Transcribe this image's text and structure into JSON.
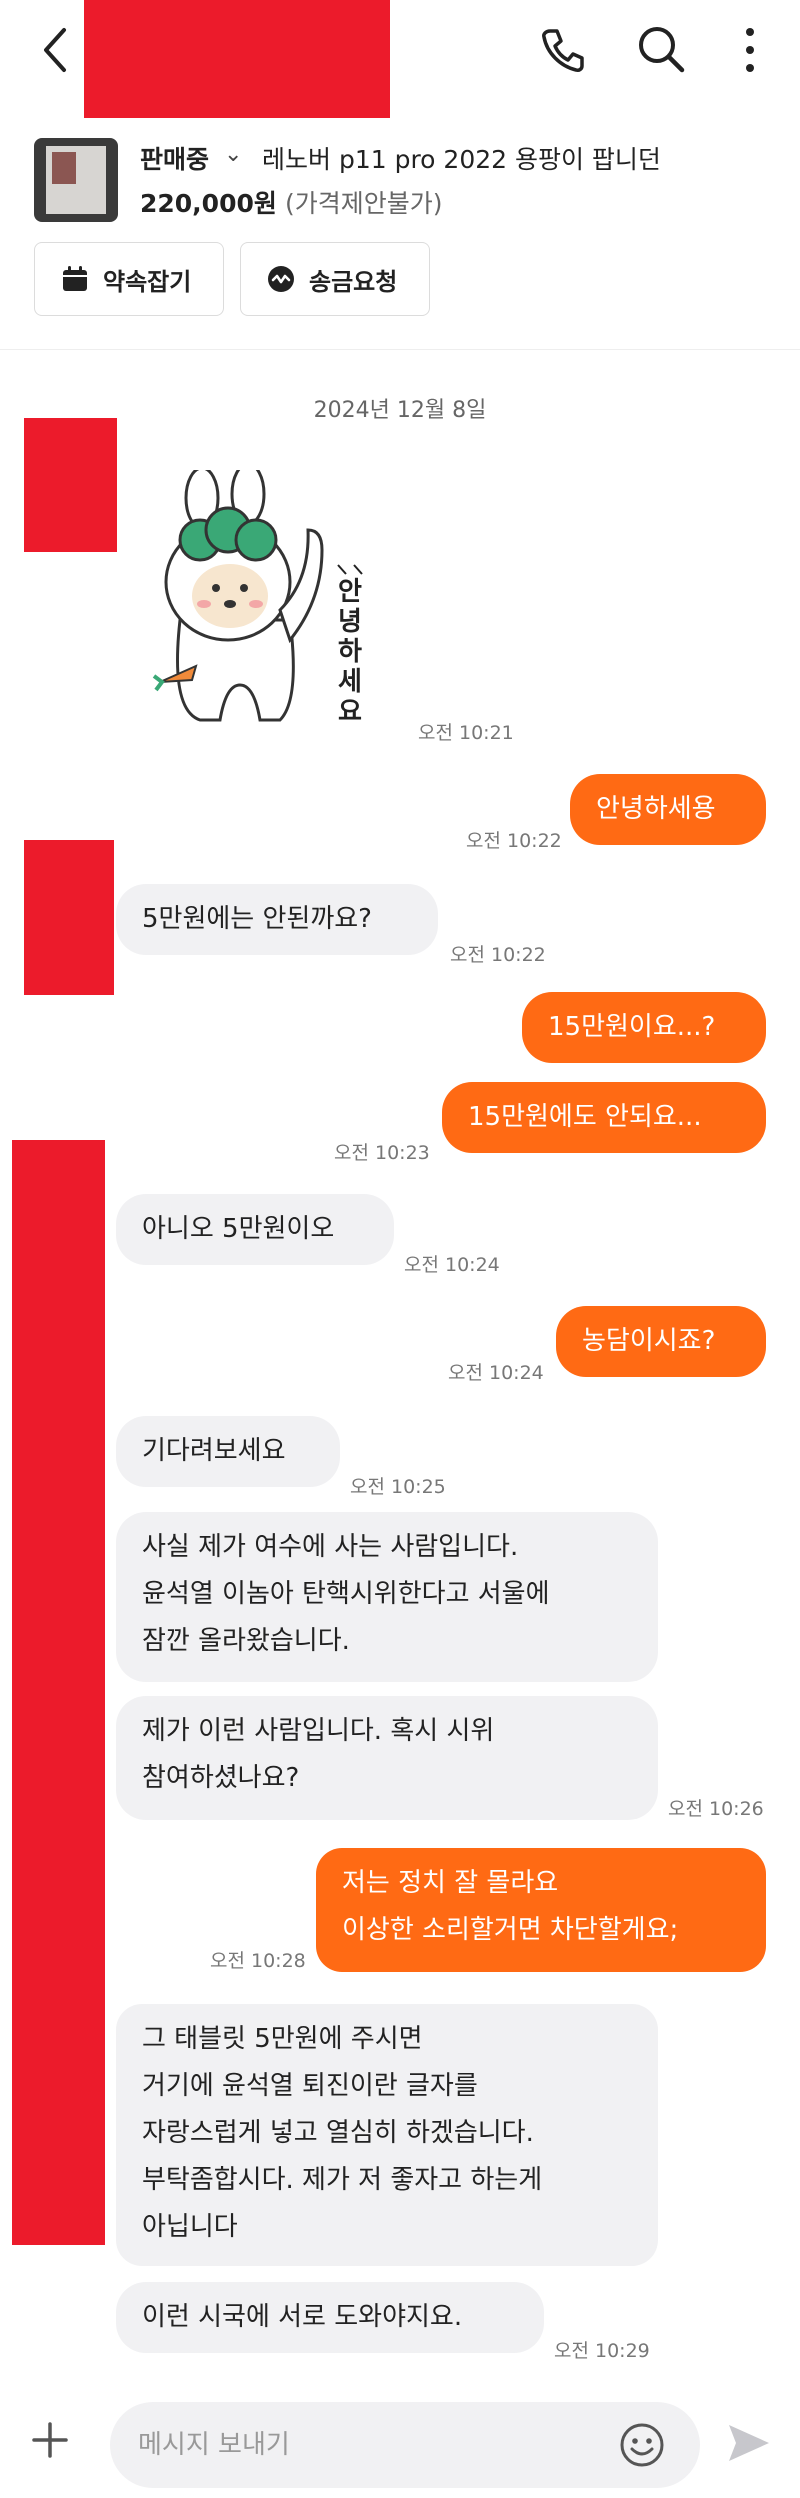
{
  "header": {
    "back_icon": "chevron-left-icon",
    "call_icon": "phone-icon",
    "search_icon": "search-icon",
    "more_icon": "more-vertical-icon"
  },
  "product": {
    "status": "판매중",
    "title": "레노버 p11 pro 2022 용팡이 팝니던",
    "price": "220,000원",
    "price_note": "(가격제안불가)",
    "schedule_button": "약속잡기",
    "transfer_button": "송금요청"
  },
  "chat": {
    "date": "2024년 12월 8일",
    "sticker_text": "안녕하세요",
    "messages": [
      {
        "from": "other",
        "type": "sticker",
        "time": "오전 10:21"
      },
      {
        "from": "me",
        "text": "안녕하세용",
        "time": "오전 10:22"
      },
      {
        "from": "other",
        "text": "5만원에는 안된까요?",
        "time": "오전 10:22"
      },
      {
        "from": "me",
        "text": "15만원이요...?",
        "time": ""
      },
      {
        "from": "me",
        "text": "15만원에도 안되요...",
        "time": "오전 10:23"
      },
      {
        "from": "other",
        "text": "아니오 5만원이오",
        "time": "오전 10:24"
      },
      {
        "from": "me",
        "text": "농담이시죠?",
        "time": "오전 10:24"
      },
      {
        "from": "other",
        "text": "기다려보세요",
        "time": "오전 10:25"
      },
      {
        "from": "other",
        "lines": [
          "사실 제가 여수에 사는 사람입니다.",
          "윤석열 이놈아 탄핵시위한다고 서울에",
          "잠깐 올라왔습니다."
        ],
        "time": ""
      },
      {
        "from": "other",
        "lines": [
          "제가 이런 사람입니다. 혹시 시위",
          "참여하셨나요?"
        ],
        "time": "오전 10:26"
      },
      {
        "from": "me",
        "lines": [
          "저는 정치 잘 몰라요",
          "이상한 소리할거면 차단할게요;"
        ],
        "time": "오전 10:28"
      },
      {
        "from": "other",
        "lines": [
          "그 태블릿 5만원에 주시면",
          "거기에 윤석열 퇴진이란 글자를",
          "자랑스럽게 넣고 열심히 하겠습니다.",
          "부탁좀합시다. 제가 저 좋자고 하는게",
          "아닙니다"
        ],
        "time": ""
      },
      {
        "from": "other",
        "text": "이런 시국에 서로 도와야지요.",
        "time": "오전 10:29"
      }
    ]
  },
  "input": {
    "placeholder": "메시지 보내기",
    "add_icon": "plus-icon",
    "emoji_icon": "smile-icon",
    "send_icon": "send-icon"
  },
  "colors": {
    "accent": "#ff6a14",
    "redaction": "#ec1b2b",
    "received_bubble": "#f1f1f3"
  }
}
